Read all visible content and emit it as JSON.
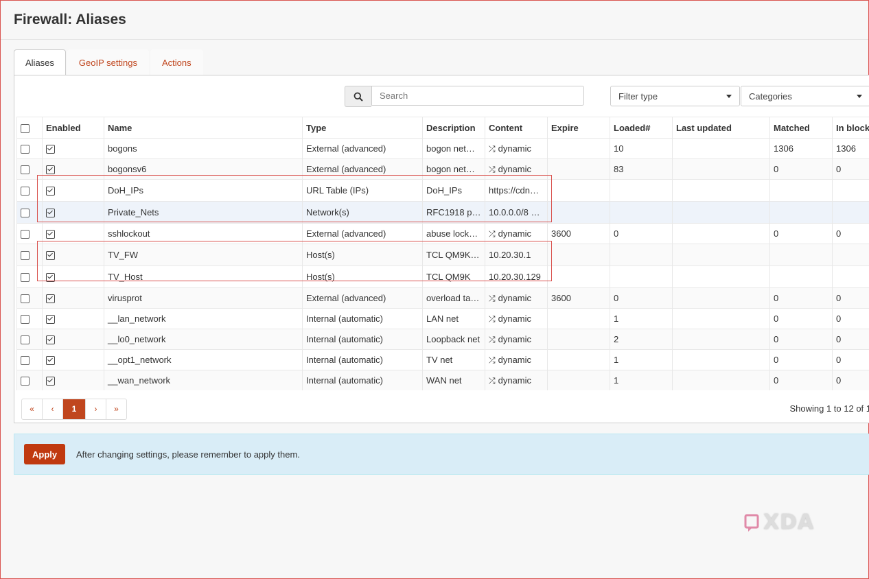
{
  "page": {
    "title": "Firewall: Aliases"
  },
  "tabs": [
    {
      "label": "Aliases",
      "active": true
    },
    {
      "label": "GeoIP settings",
      "active": false
    },
    {
      "label": "Actions",
      "active": false
    }
  ],
  "toolbar": {
    "search_placeholder": "Search",
    "search_icon": "search-icon",
    "filter_type": "Filter type",
    "categories": "Categories"
  },
  "table": {
    "headers": [
      "Enabled",
      "Name",
      "Type",
      "Description",
      "Content",
      "Expire",
      "Loaded#",
      "Last updated",
      "Matched",
      "In block"
    ],
    "rows": [
      {
        "name": "bogons",
        "type": "External (advanced)",
        "description": "bogon net…",
        "content": "dynamic",
        "expire": "",
        "loaded": "10",
        "last_updated": "",
        "matched": "1306",
        "in_block": "1306"
      },
      {
        "name": "bogonsv6",
        "type": "External (advanced)",
        "description": "bogon net…",
        "content": "dynamic",
        "expire": "",
        "loaded": "83",
        "last_updated": "",
        "matched": "0",
        "in_block": "0"
      },
      {
        "name": "DoH_IPs",
        "type": "URL Table (IPs)",
        "description": "DoH_IPs",
        "content": "https://cdn…",
        "expire": "",
        "loaded": "",
        "last_updated": "",
        "matched": "",
        "in_block": ""
      },
      {
        "name": "Private_Nets",
        "type": "Network(s)",
        "description": "RFC1918 pr…",
        "content": "10.0.0.0/8 1…",
        "expire": "",
        "loaded": "",
        "last_updated": "",
        "matched": "",
        "in_block": ""
      },
      {
        "name": "sshlockout",
        "type": "External (advanced)",
        "description": "abuse lock…",
        "content": "dynamic",
        "expire": "3600",
        "loaded": "0",
        "last_updated": "",
        "matched": "0",
        "in_block": "0"
      },
      {
        "name": "TV_FW",
        "type": "Host(s)",
        "description": "TCL QM9K …",
        "content": "10.20.30.1",
        "expire": "",
        "loaded": "",
        "last_updated": "",
        "matched": "",
        "in_block": ""
      },
      {
        "name": "TV_Host",
        "type": "Host(s)",
        "description": "TCL QM9K",
        "content": "10.20.30.129",
        "expire": "",
        "loaded": "",
        "last_updated": "",
        "matched": "",
        "in_block": ""
      },
      {
        "name": "virusprot",
        "type": "External (advanced)",
        "description": "overload ta…",
        "content": "dynamic",
        "expire": "3600",
        "loaded": "0",
        "last_updated": "",
        "matched": "0",
        "in_block": "0"
      },
      {
        "name": "__lan_network",
        "type": "Internal (automatic)",
        "description": "LAN net",
        "content": "dynamic",
        "expire": "",
        "loaded": "1",
        "last_updated": "",
        "matched": "0",
        "in_block": "0"
      },
      {
        "name": "__lo0_network",
        "type": "Internal (automatic)",
        "description": "Loopback net",
        "content": "dynamic",
        "expire": "",
        "loaded": "2",
        "last_updated": "",
        "matched": "0",
        "in_block": "0"
      },
      {
        "name": "__opt1_network",
        "type": "Internal (automatic)",
        "description": "TV net",
        "content": "dynamic",
        "expire": "",
        "loaded": "1",
        "last_updated": "",
        "matched": "0",
        "in_block": "0"
      },
      {
        "name": "__wan_network",
        "type": "Internal (automatic)",
        "description": "WAN net",
        "content": "dynamic",
        "expire": "",
        "loaded": "1",
        "last_updated": "",
        "matched": "0",
        "in_block": "0"
      }
    ]
  },
  "pagination": {
    "first": "«",
    "prev": "‹",
    "current": "1",
    "next": "›",
    "last": "»",
    "showing": "Showing 1 to 12 of 1"
  },
  "notice": {
    "apply_label": "Apply",
    "text": "After changing settings, please remember to apply them."
  },
  "watermark": {
    "text": "XDA"
  },
  "colors": {
    "accent": "#c0461e",
    "apply": "#c0390f",
    "notice_bg": "#d9edf7",
    "highlight": "#d9534f"
  }
}
